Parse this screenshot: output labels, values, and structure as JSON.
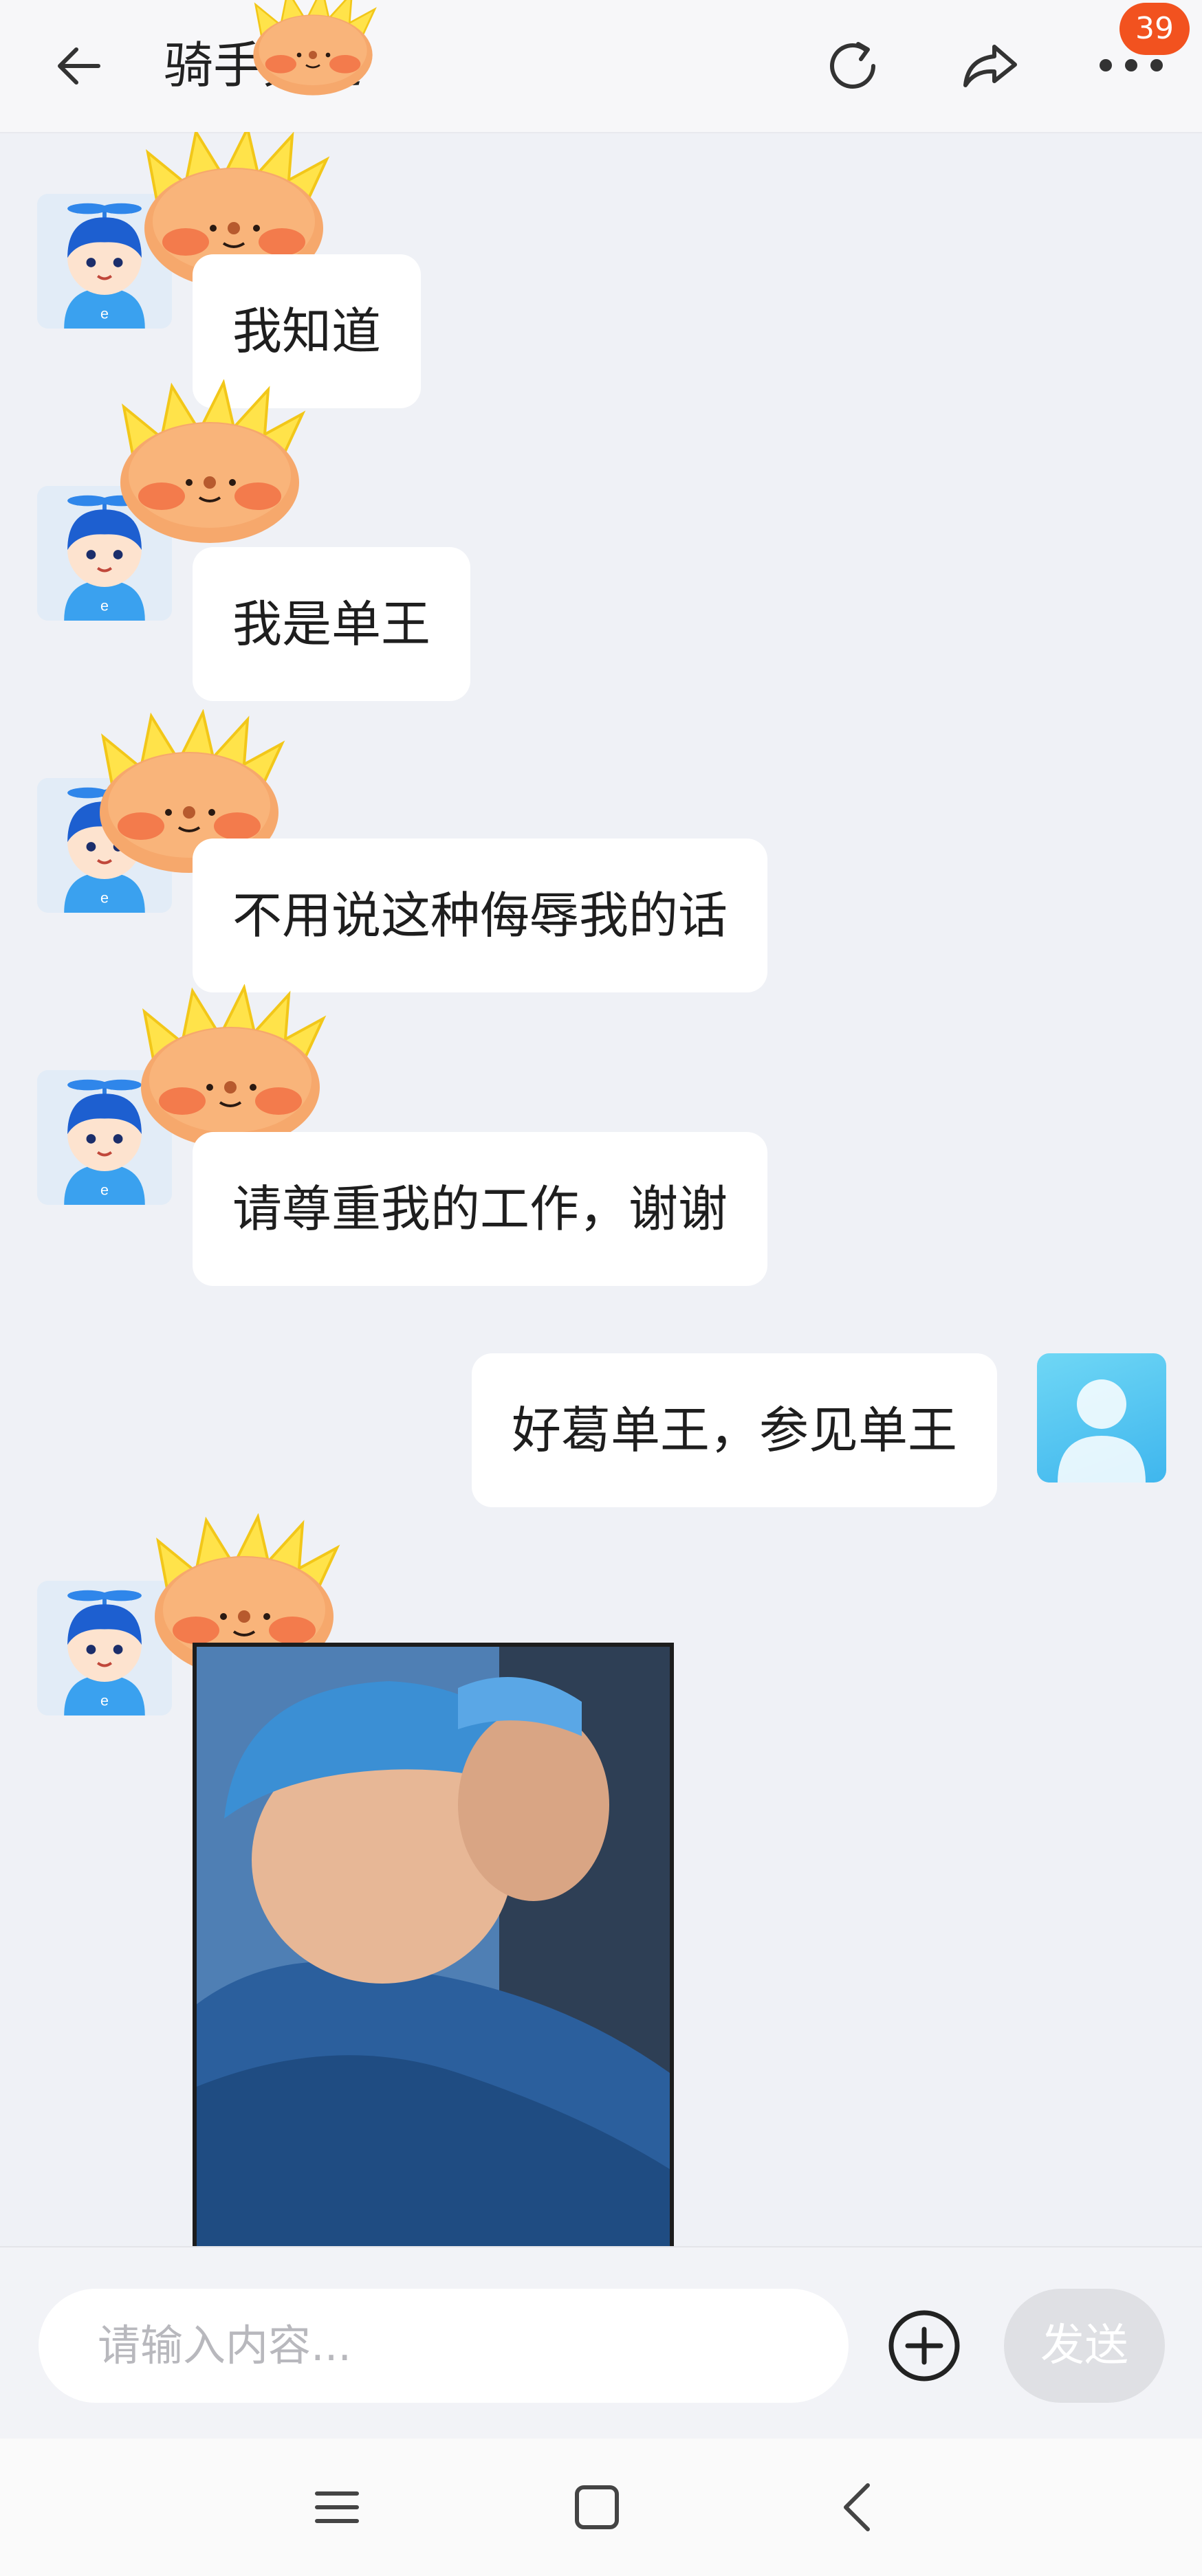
{
  "header": {
    "title": "骑手频道",
    "badge_count": "39",
    "icons": [
      "back-arrow-icon",
      "refresh-icon",
      "share-icon",
      "more-icon"
    ]
  },
  "messages": [
    {
      "side": "left",
      "text": "我知道"
    },
    {
      "side": "left",
      "text": "我是单王"
    },
    {
      "side": "left",
      "text": "不用说这种侮辱我的话"
    },
    {
      "side": "left",
      "text": "请尊重我的工作，谢谢"
    },
    {
      "side": "right",
      "text": "好葛单王，参见单王"
    },
    {
      "side": "left",
      "type": "image"
    }
  ],
  "input": {
    "placeholder": "请输入内容...",
    "send_label": "发送"
  },
  "navbar": {
    "icons": [
      "menu-icon",
      "home-square-icon",
      "back-chevron-icon"
    ]
  },
  "colors": {
    "badge": "#f2521f",
    "background": "#eff1f6",
    "bubble": "#ffffff",
    "send_disabled": "#dfe0e4"
  }
}
